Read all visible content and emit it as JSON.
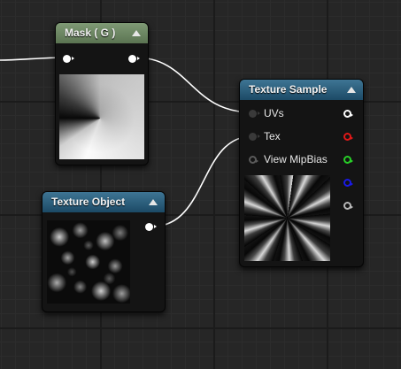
{
  "nodes": {
    "mask": {
      "title": "Mask ( G )",
      "collapse_icon": "collapse-arrow-icon"
    },
    "texture_sample": {
      "title": "Texture Sample",
      "inputs": [
        {
          "label": "UVs",
          "connected": true
        },
        {
          "label": "Tex",
          "connected": true
        },
        {
          "label": "View MipBias",
          "connected": false
        }
      ],
      "outputs": [
        {
          "channel": "rgb",
          "color": "#ffffff"
        },
        {
          "channel": "r",
          "color": "#e01818"
        },
        {
          "channel": "g",
          "color": "#28d028"
        },
        {
          "channel": "b",
          "color": "#1a1ae6"
        },
        {
          "channel": "a",
          "color": "#b8b8b8"
        }
      ]
    },
    "texture_object": {
      "title": "Texture Object"
    }
  },
  "wires": [
    {
      "from": "offscreen-left",
      "to": "mask.input"
    },
    {
      "from": "mask.output",
      "to": "texture_sample.uvs"
    },
    {
      "from": "texture_object.output",
      "to": "texture_sample.tex"
    }
  ],
  "colors": {
    "canvas_bg": "#262626",
    "mask_header": "#6b8562",
    "texture_header": "#2a5f80",
    "wire": "#ffffff"
  }
}
